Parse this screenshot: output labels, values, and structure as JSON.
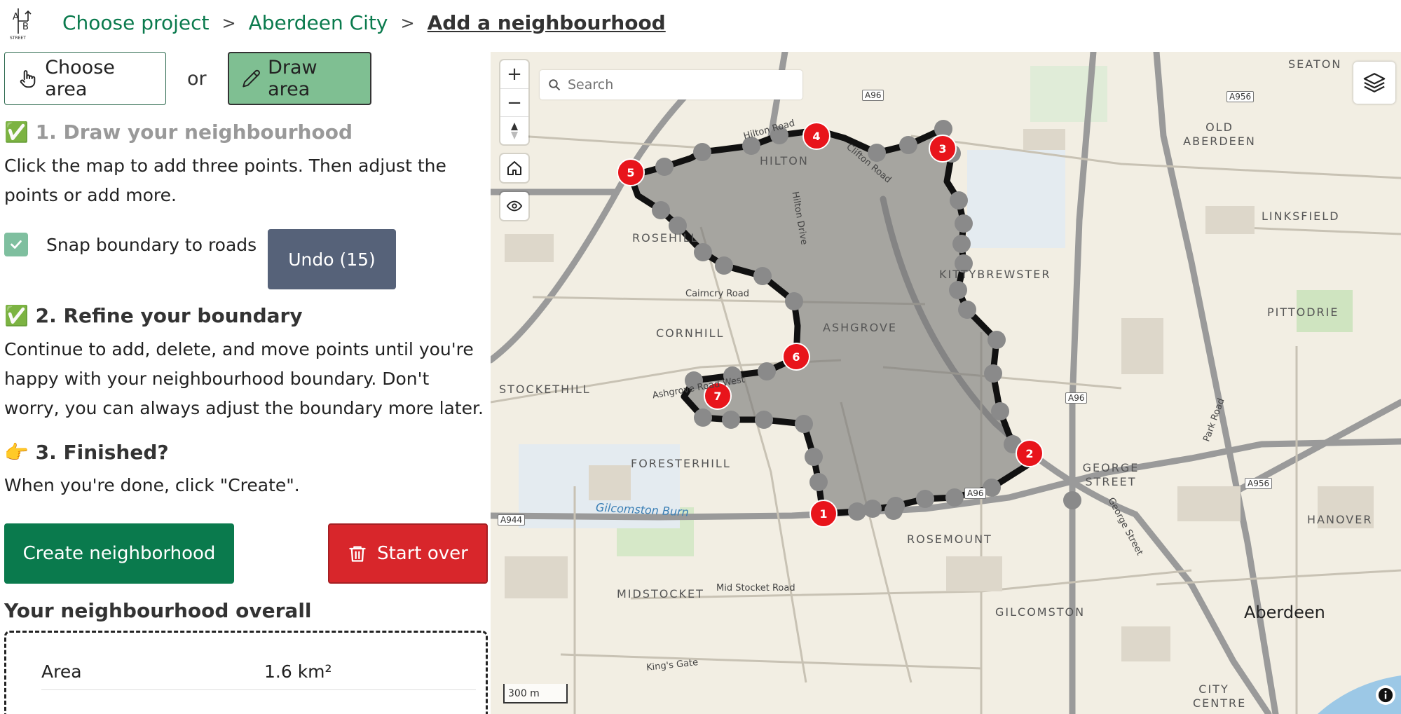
{
  "header": {
    "breadcrumbs": [
      "Choose project",
      "Aberdeen City"
    ],
    "separator": ">",
    "current": "Add a neighbourhood"
  },
  "sidebar": {
    "choose_area_label": "Choose area",
    "or_label": "or",
    "draw_area_label": "Draw area",
    "step1": {
      "title": "✅ 1. Draw your neighbourhood",
      "text": "Click the map to add three points. Then adjust the points or add more."
    },
    "snap_label": "Snap boundary to roads",
    "snap_checked": true,
    "undo_label": "Undo (15)",
    "step2": {
      "title": "✅ 2. Refine your boundary",
      "text": "Continue to add, delete, and move points until you're happy with your neighbourhood boundary. Don't worry, you can always adjust the boundary more later."
    },
    "step3": {
      "title": "👉 3. Finished?",
      "text": "When you're done, click \"Create\"."
    },
    "create_label": "Create neighborhood",
    "start_over_label": "Start over",
    "overall_title": "Your neighbourhood overall",
    "stats": [
      {
        "label": "Area",
        "value": "1.6 km²"
      }
    ]
  },
  "map": {
    "search_placeholder": "Search",
    "zoom_in": "+",
    "zoom_out": "−",
    "scale_label": "300 m",
    "places": [
      "SEATON",
      "OLD ABERDEEN",
      "LINKSFIELD",
      "PITTODRIE",
      "HILTON",
      "ROSEHILL",
      "KITTYBREWSTER",
      "ASHGROVE",
      "CORNHILL",
      "STOCKETHILL",
      "FORESTERHILL",
      "GEORGE STREET",
      "HANOVER",
      "ROSEMOUNT",
      "MIDSTOCKET",
      "GILCOMSTON",
      "CITY CENTRE",
      "Aberdeen"
    ],
    "roads": [
      "Cairncry Road",
      "Hilton Drive",
      "Mid Stocket Road",
      "King's Gate",
      "Park Road",
      "George Street",
      "Ashgrove Road West",
      "Clifton Road",
      "Hilton Road"
    ],
    "shields": [
      "A96",
      "A956",
      "A96",
      "A956",
      "A944",
      "A96"
    ],
    "water": "Gilcomston Burn",
    "vertices": [
      "1",
      "2",
      "3",
      "4",
      "5",
      "6",
      "7"
    ],
    "colors": {
      "vertex": "#e8141b",
      "polygon": "#808080",
      "road": "#9a9a9a"
    }
  }
}
